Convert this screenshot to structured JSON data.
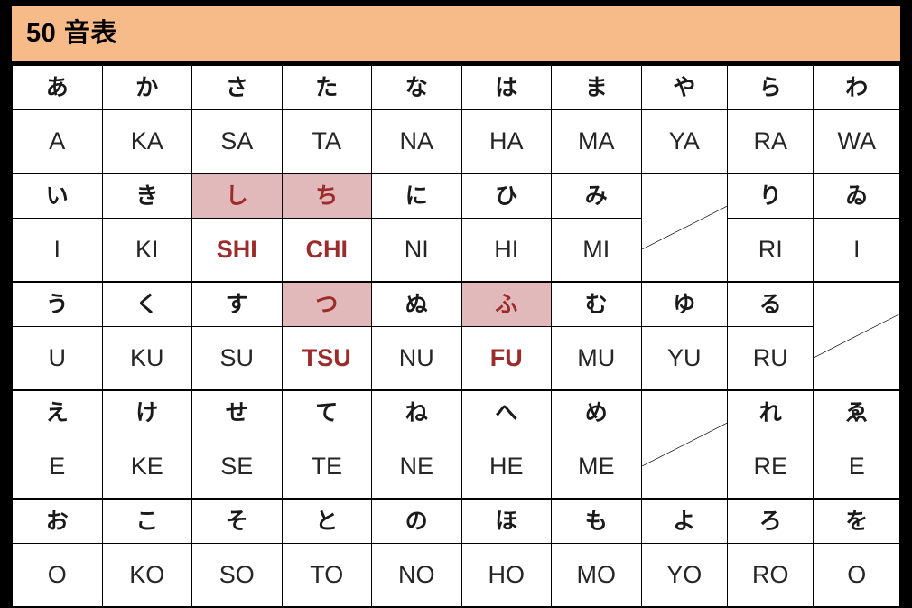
{
  "header": {
    "title": "50 音表",
    "background_color": "#f7bb8a"
  },
  "colors": {
    "kana_row_bg": "#d9e4bc",
    "romaji_row_bg": "#ffffff",
    "highlight_bg": "#e2b9bb",
    "highlight_text": "#9c2b2b",
    "text": "#1a1a1a",
    "border": "#000000",
    "page_border": "#000000"
  },
  "table": {
    "columns": [
      "a",
      "ka",
      "sa",
      "ta",
      "na",
      "ha",
      "ma",
      "ya",
      "ra",
      "wa"
    ],
    "rows": [
      {
        "vowel": "a",
        "kana": [
          "あ",
          "か",
          "さ",
          "た",
          "な",
          "は",
          "ま",
          "や",
          "ら",
          "わ"
        ],
        "romaji": [
          "A",
          "KA",
          "SA",
          "TA",
          "NA",
          "HA",
          "MA",
          "YA",
          "RA",
          "WA"
        ],
        "highlight": [
          false,
          false,
          false,
          false,
          false,
          false,
          false,
          false,
          false,
          false
        ],
        "blank": [
          false,
          false,
          false,
          false,
          false,
          false,
          false,
          false,
          false,
          false
        ]
      },
      {
        "vowel": "i",
        "kana": [
          "い",
          "き",
          "し",
          "ち",
          "に",
          "ひ",
          "み",
          "",
          "り",
          "ゐ"
        ],
        "romaji": [
          "I",
          "KI",
          "SHI",
          "CHI",
          "NI",
          "HI",
          "MI",
          "",
          "RI",
          "I"
        ],
        "highlight": [
          false,
          false,
          true,
          true,
          false,
          false,
          false,
          false,
          false,
          false
        ],
        "blank": [
          false,
          false,
          false,
          false,
          false,
          false,
          false,
          true,
          false,
          false
        ]
      },
      {
        "vowel": "u",
        "kana": [
          "う",
          "く",
          "す",
          "つ",
          "ぬ",
          "ふ",
          "む",
          "ゆ",
          "る",
          ""
        ],
        "romaji": [
          "U",
          "KU",
          "SU",
          "TSU",
          "NU",
          "FU",
          "MU",
          "YU",
          "RU",
          ""
        ],
        "highlight": [
          false,
          false,
          false,
          true,
          false,
          true,
          false,
          false,
          false,
          false
        ],
        "blank": [
          false,
          false,
          false,
          false,
          false,
          false,
          false,
          false,
          false,
          true
        ]
      },
      {
        "vowel": "e",
        "kana": [
          "え",
          "け",
          "せ",
          "て",
          "ね",
          "へ",
          "め",
          "",
          "れ",
          "ゑ"
        ],
        "romaji": [
          "E",
          "KE",
          "SE",
          "TE",
          "NE",
          "HE",
          "ME",
          "",
          "RE",
          "E"
        ],
        "highlight": [
          false,
          false,
          false,
          false,
          false,
          false,
          false,
          false,
          false,
          false
        ],
        "blank": [
          false,
          false,
          false,
          false,
          false,
          false,
          false,
          true,
          false,
          false
        ]
      },
      {
        "vowel": "o",
        "kana": [
          "お",
          "こ",
          "そ",
          "と",
          "の",
          "ほ",
          "も",
          "よ",
          "ろ",
          "を"
        ],
        "romaji": [
          "O",
          "KO",
          "SO",
          "TO",
          "NO",
          "HO",
          "MO",
          "YO",
          "RO",
          "O"
        ],
        "highlight": [
          false,
          false,
          false,
          false,
          false,
          false,
          false,
          false,
          false,
          false
        ],
        "blank": [
          false,
          false,
          false,
          false,
          false,
          false,
          false,
          false,
          false,
          false
        ]
      }
    ]
  }
}
